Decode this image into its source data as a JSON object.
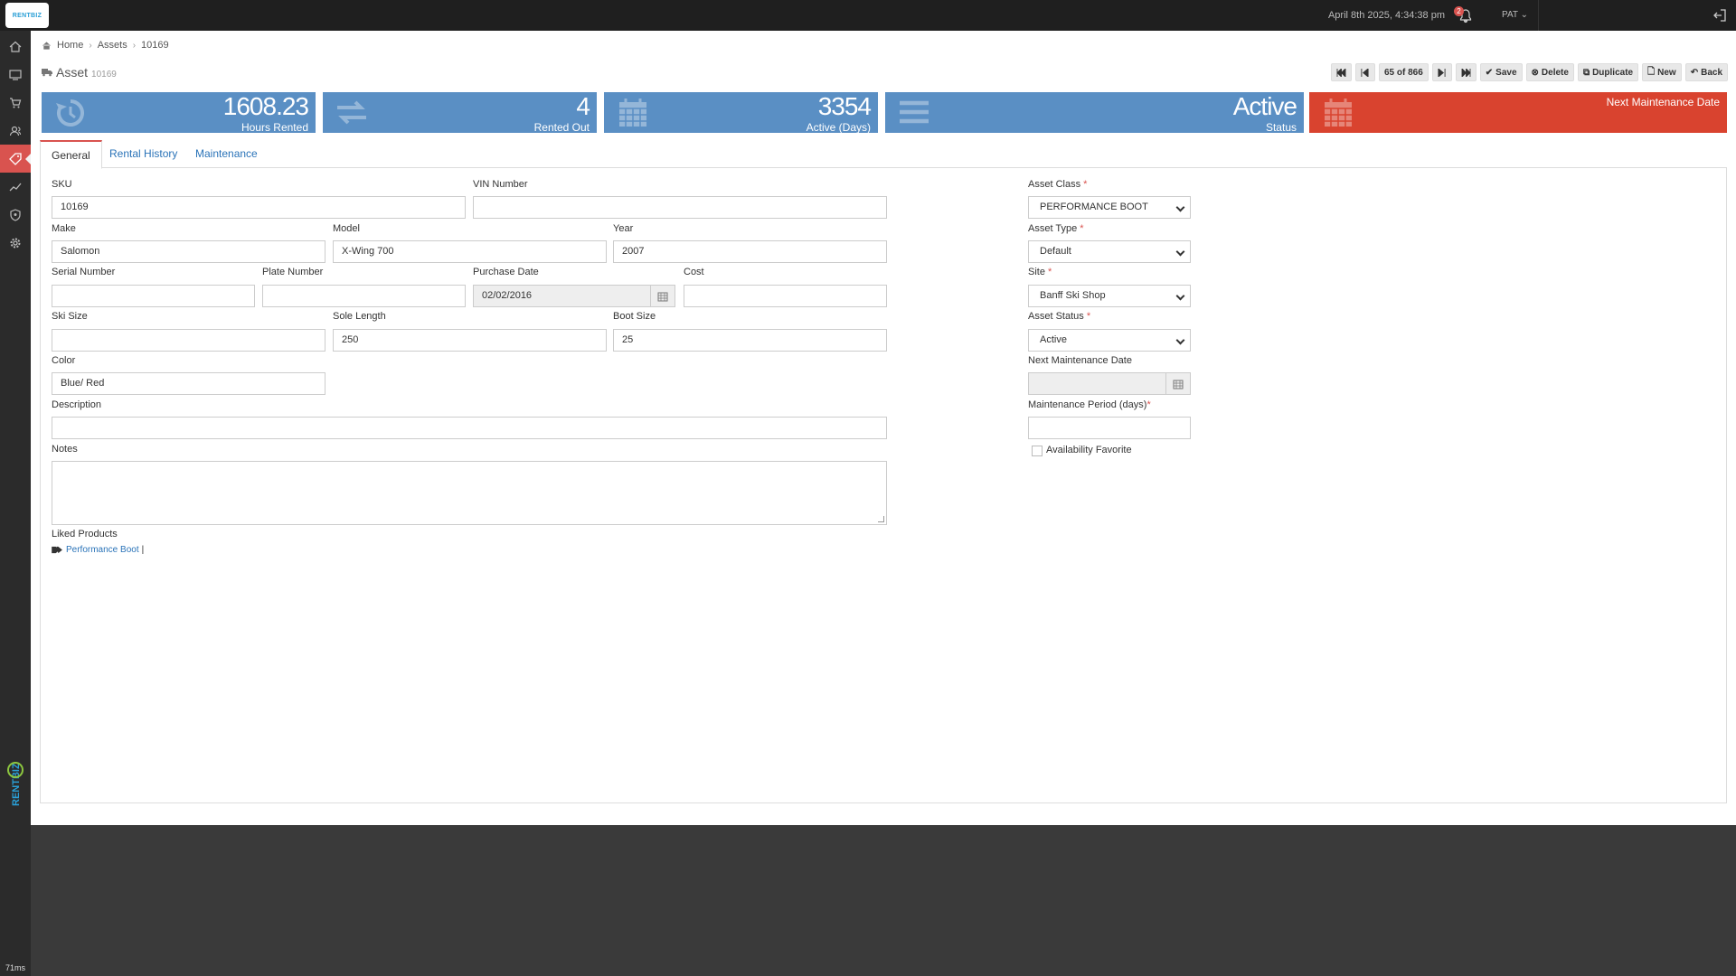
{
  "topbar": {
    "logo": "RENTBIZ",
    "datetime": "April 8th 2025, 4:34:38 pm",
    "notification_count": "2",
    "user": "PAT"
  },
  "sidebar": {
    "icons": [
      "home-icon",
      "monitor-icon",
      "cart-icon",
      "users-icon",
      "tag-icon",
      "chart-icon",
      "shield-icon",
      "gear-icon"
    ],
    "active": "tag-icon",
    "brand_text": "RENTBIZ",
    "timing": "71ms"
  },
  "breadcrumb": {
    "home": "Home",
    "assets": "Assets",
    "current": "10169"
  },
  "title": {
    "label": "Asset",
    "id": "10169"
  },
  "toolbar": {
    "record_position": "65 of 866",
    "save": "Save",
    "delete": "Delete",
    "duplicate": "Duplicate",
    "new": "New",
    "back": "Back"
  },
  "cards": [
    {
      "value": "1608.23",
      "label": "Hours Rented",
      "icon": "history-icon"
    },
    {
      "value": "4",
      "label": "Rented Out",
      "icon": "exchange-icon"
    },
    {
      "value": "3354",
      "label": "Active (Days)",
      "icon": "calendar-icon"
    },
    {
      "value": "Active",
      "label": "Status",
      "icon": "bars-icon"
    },
    {
      "value": "",
      "label": "Next Maintenance Date",
      "icon": "calendar-icon"
    }
  ],
  "colors": {
    "card_blue": "#5a8fc4",
    "card_red": "#d9432f",
    "accent": "#d9534f",
    "link": "#2a73b8"
  },
  "tabs": [
    "General",
    "Rental History",
    "Maintenance"
  ],
  "form": {
    "sku": {
      "label": "SKU",
      "value": "10169"
    },
    "vin": {
      "label": "VIN Number",
      "value": ""
    },
    "make": {
      "label": "Make",
      "value": "Salomon"
    },
    "model": {
      "label": "Model",
      "value": "X-Wing 700"
    },
    "year": {
      "label": "Year",
      "value": "2007"
    },
    "serial": {
      "label": "Serial Number",
      "value": ""
    },
    "plate": {
      "label": "Plate Number",
      "value": ""
    },
    "purchase_date": {
      "label": "Purchase Date",
      "value": "02/02/2016"
    },
    "cost": {
      "label": "Cost",
      "value": ""
    },
    "ski_size": {
      "label": "Ski Size",
      "value": ""
    },
    "sole_length": {
      "label": "Sole Length",
      "value": "250"
    },
    "boot_size": {
      "label": "Boot Size",
      "value": "25"
    },
    "color": {
      "label": "Color",
      "value": "Blue/ Red"
    },
    "description": {
      "label": "Description",
      "value": ""
    },
    "notes": {
      "label": "Notes",
      "value": ""
    },
    "liked_products": {
      "label": "Liked Products",
      "item": "Performance Boot",
      "sep": "|"
    },
    "asset_class": {
      "label": "Asset Class",
      "value": "PERFORMANCE BOOT"
    },
    "asset_type": {
      "label": "Asset Type",
      "value": "Default"
    },
    "site": {
      "label": "Site",
      "value": "Banff Ski Shop"
    },
    "asset_status": {
      "label": "Asset Status",
      "value": "Active"
    },
    "next_maintenance": {
      "label": "Next Maintenance Date",
      "value": ""
    },
    "maintenance_period": {
      "label": "Maintenance Period (days)",
      "value": ""
    },
    "availability_favorite": {
      "label": "Availability Favorite",
      "checked": false
    }
  }
}
